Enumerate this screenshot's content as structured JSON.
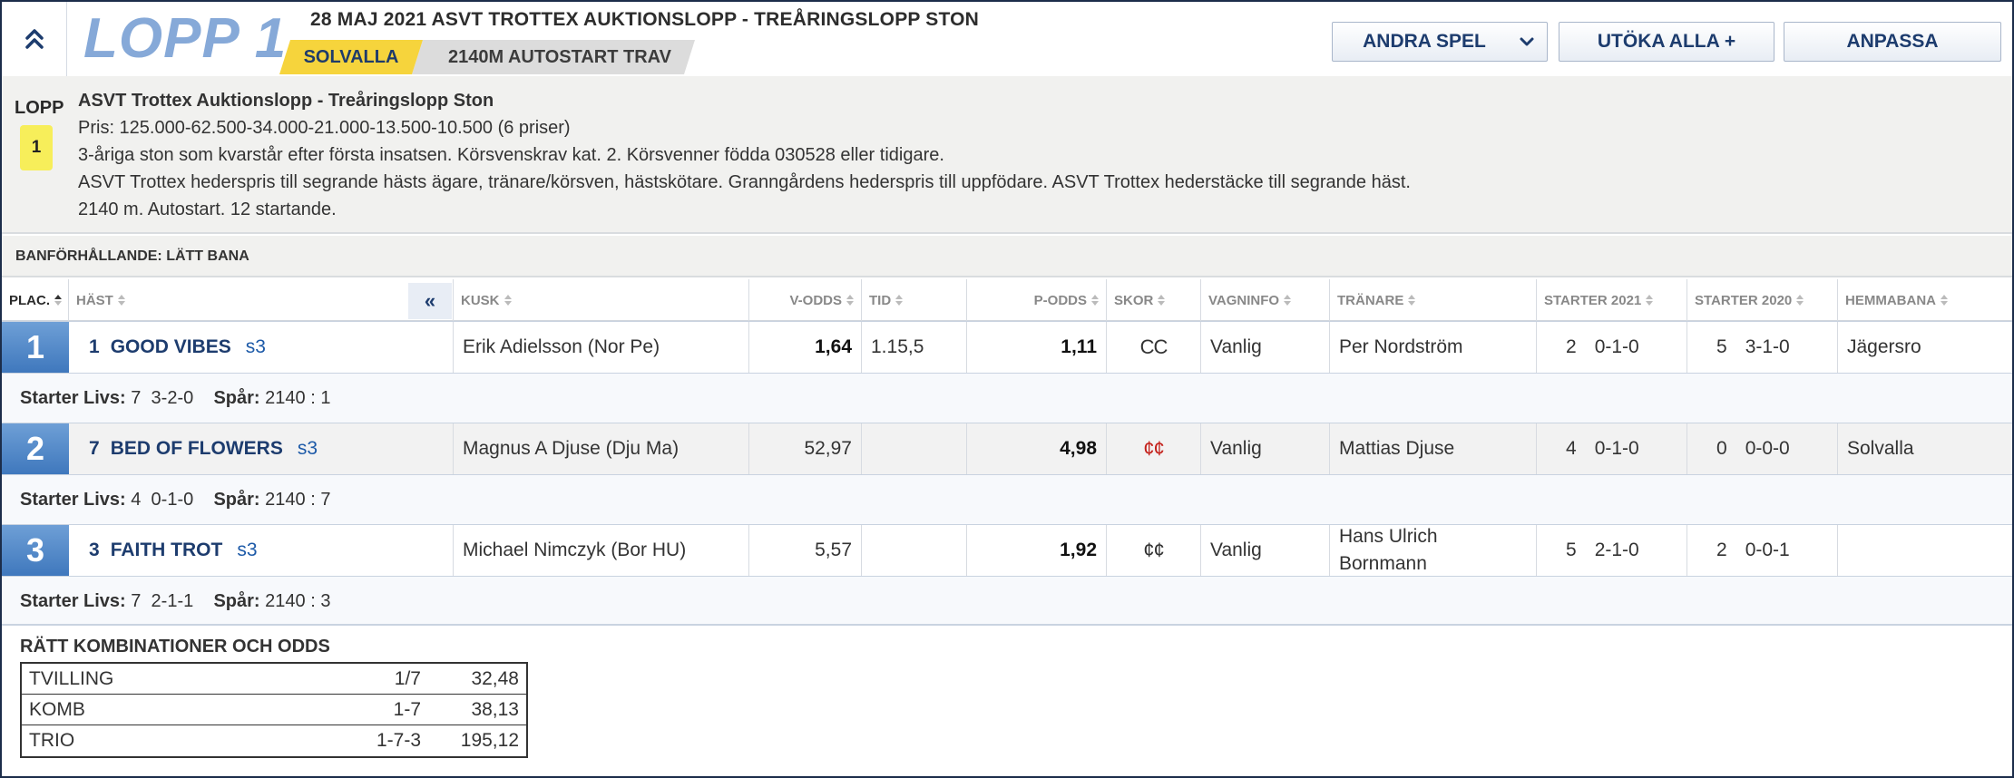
{
  "header": {
    "lopp_title": "LOPP 1",
    "race_title": "28 MAJ 2021 ASVT TROTTEX AUKTIONSLOPP - TREÅRINGSLOPP STON",
    "track": "SOLVALLA",
    "start_info": "2140M AUTOSTART TRAV",
    "buttons": {
      "andra": "ANDRA SPEL",
      "utoka": "UTÖKA ALLA +",
      "anpassa": "ANPASSA"
    }
  },
  "info": {
    "lopp_label": "LOPP",
    "lopp_number": "1",
    "lines": [
      "ASVT Trottex Auktionslopp - Treåringslopp Ston",
      "Pris: 125.000-62.500-34.000-21.000-13.500-10.500 (6 priser)",
      "3-åriga ston som kvarstår efter första insatsen. Körsvenskrav kat. 2. Körsvenner födda 030528 eller tidigare.",
      "ASVT Trottex hederspris till segrande hästs ägare, tränare/körsven, hästskötare. Granngårdens hederspris till uppfödare. ASVT Trottex hederstäcke till segrande häst.",
      "2140 m. Autostart. 12 startande."
    ]
  },
  "banforhallande": "BANFÖRHÅLLANDE: LÄTT BANA",
  "table": {
    "collapse_label": "«",
    "columns": {
      "plac": "PLAC.",
      "hast": "HÄST",
      "kusk": "KUSK",
      "vodds": "V-ODDS",
      "tid": "TID",
      "podds": "P-ODDS",
      "skor": "SKOR",
      "vagninfo": "VAGNINFO",
      "tranare": "TRÄNARE",
      "starter2021": "STARTER 2021",
      "starter2020": "STARTER 2020",
      "hemmabana": "HEMMABANA"
    },
    "rows": [
      {
        "place": "1",
        "number": "1",
        "horse": "GOOD VIBES",
        "s": "s3",
        "driver": "Erik Adielsson (Nor Pe)",
        "vodds": "1,64",
        "time": "1.15,5",
        "podds": "1,11",
        "shoes": "CC",
        "cart": "Vanlig",
        "trainer_l1": "Per Nordström",
        "trainer_l2": "",
        "s2021_n": "2",
        "s2021_r": "0-1-0",
        "s2020_n": "5",
        "s2020_r": "3-1-0",
        "home": "Jägersro",
        "sub": {
          "livs_label": "Starter Livs:",
          "livs_n": "7",
          "livs_r": "3-2-0",
          "spar_label": "Spår:",
          "spar": "2140 : 1"
        }
      },
      {
        "place": "2",
        "number": "7",
        "horse": "BED OF FLOWERS",
        "s": "s3",
        "driver": "Magnus A Djuse (Dju Ma)",
        "vodds": "52,97",
        "time": "",
        "podds": "4,98",
        "shoes": "¢¢",
        "cart": "Vanlig",
        "trainer_l1": "Mattias Djuse",
        "trainer_l2": "",
        "s2021_n": "4",
        "s2021_r": "0-1-0",
        "s2020_n": "0",
        "s2020_r": "0-0-0",
        "home": "Solvalla",
        "sub": {
          "livs_label": "Starter Livs:",
          "livs_n": "4",
          "livs_r": "0-1-0",
          "spar_label": "Spår:",
          "spar": "2140 : 7"
        }
      },
      {
        "place": "3",
        "number": "3",
        "horse": "FAITH TROT",
        "s": "s3",
        "driver": "Michael Nimczyk (Bor HU)",
        "vodds": "5,57",
        "time": "",
        "podds": "1,92",
        "shoes": "¢¢",
        "cart": "Vanlig",
        "trainer_l1": "Hans Ulrich",
        "trainer_l2": "Bornmann",
        "s2021_n": "5",
        "s2021_r": "2-1-0",
        "s2020_n": "2",
        "s2020_r": "0-0-1",
        "home": "",
        "sub": {
          "livs_label": "Starter Livs:",
          "livs_n": "7",
          "livs_r": "2-1-1",
          "spar_label": "Spår:",
          "spar": "2140 : 3"
        }
      }
    ]
  },
  "combos": {
    "title": "RÄTT KOMBINATIONER OCH ODDS",
    "rows": [
      {
        "name": "TVILLING",
        "combination": "1/7",
        "odds": "32,48"
      },
      {
        "name": "KOMB",
        "combination": "1-7",
        "odds": "38,13"
      },
      {
        "name": "TRIO",
        "combination": "1-7-3",
        "odds": "195,12"
      }
    ]
  },
  "colors": {
    "navy": "#1d3c6e",
    "lopp_blue": "#86a9d8",
    "track_yellow": "#f6d43c",
    "place_blue": "#3f78bd",
    "shoe_red": "#c4221c"
  }
}
